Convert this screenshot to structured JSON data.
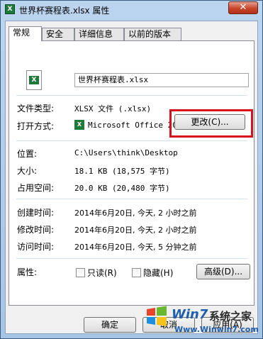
{
  "window": {
    "title": "世界杯赛程表.xlsx 属性",
    "close_glyph": "✕"
  },
  "tabs": [
    {
      "label": "常规",
      "active": true
    },
    {
      "label": "安全"
    },
    {
      "label": "详细信息"
    },
    {
      "label": "以前的版本"
    }
  ],
  "file": {
    "icon": "excel-file-icon",
    "name": "世界杯赛程表.xlsx"
  },
  "fields": {
    "type_label": "文件类型:",
    "type_value": "XLSX 文件 (.xlsx)",
    "opens_label": "打开方式:",
    "opens_value": "Microsoft Office 20",
    "change_button": "更改(C)...",
    "location_label": "位置:",
    "location_value": "C:\\Users\\think\\Desktop",
    "size_label": "大小:",
    "size_value": "18.1 KB (18,575 字节)",
    "disk_label": "占用空间:",
    "disk_value": "20.0 KB (20,480 字节)",
    "created_label": "创建时间:",
    "created_value": "2014年6月20日, 今天, 2 小时之前",
    "modified_label": "修改时间:",
    "modified_value": "2014年6月20日, 今天, 2 小时之前",
    "accessed_label": "访问时间:",
    "accessed_value": "2014年6月20日, 今天, 5 分钟之前",
    "attributes_label": "属性:",
    "readonly_label": "只读(R)",
    "hidden_label": "隐藏(H)",
    "advanced_button": "高级(D)..."
  },
  "buttons": {
    "ok": "确定",
    "cancel": "取消",
    "apply": "应用(A)"
  },
  "watermark": {
    "brand": "Win7",
    "sub": "系统之家",
    "url": "Www.Winwin7.com"
  },
  "colors": {
    "highlight": "#d8101a",
    "excel_green": "#1f7a3a"
  }
}
